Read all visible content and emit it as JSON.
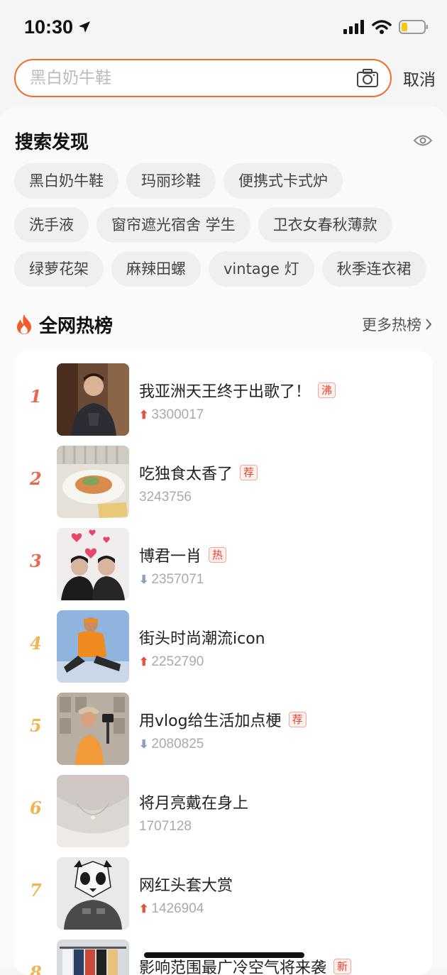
{
  "status_bar": {
    "time": "10:30"
  },
  "search": {
    "placeholder": "黑白奶牛鞋",
    "cancel_label": "取消"
  },
  "discover": {
    "title": "搜索发现",
    "rows": [
      [
        "黑白奶牛鞋",
        "玛丽珍鞋",
        "便携式卡式炉"
      ],
      [
        "洗手液",
        "窗帘遮光宿舍 学生",
        "卫衣女春秋薄款"
      ],
      [
        "绿萝花架",
        "麻辣田螺",
        "vintage 灯",
        "秋季连衣裙"
      ]
    ]
  },
  "hot": {
    "title": "全网热榜",
    "more_label": "更多热榜",
    "items": [
      {
        "rank": "1",
        "title": "我亚洲天王终于出歌了！",
        "badge": "沸",
        "trend": "up",
        "count": "3300017",
        "thumb": "portrait-dark-jacket"
      },
      {
        "rank": "2",
        "title": "吃独食太香了",
        "badge": "荐",
        "trend": "none",
        "count": "3243756",
        "thumb": "plate-of-food"
      },
      {
        "rank": "3",
        "title": "博君一肖",
        "badge": "热",
        "trend": "down",
        "count": "2357071",
        "thumb": "two-people-hearts"
      },
      {
        "rank": "4",
        "title": "街头时尚潮流icon",
        "badge": "",
        "trend": "up",
        "count": "2252790",
        "thumb": "orange-hoodie-man"
      },
      {
        "rank": "5",
        "title": "用vlog给生活加点梗",
        "badge": "荐",
        "trend": "down",
        "count": "2080825",
        "thumb": "vlogger-camera"
      },
      {
        "rank": "6",
        "title": "将月亮戴在身上",
        "badge": "",
        "trend": "none",
        "count": "1707128",
        "thumb": "moon-necklace"
      },
      {
        "rank": "7",
        "title": "网红头套大赏",
        "badge": "",
        "trend": "up",
        "count": "1426904",
        "thumb": "panda-mask"
      },
      {
        "rank": "8",
        "title": "影响范围最广冷空气将来袭",
        "badge": "新",
        "trend": "none",
        "count": "",
        "thumb": "clothing-rack"
      }
    ]
  },
  "colors": {
    "accent": "#f26b2f",
    "rank_top": "#e8674a",
    "rank_rest": "#f0b552",
    "badge_text": "#e0442f"
  }
}
